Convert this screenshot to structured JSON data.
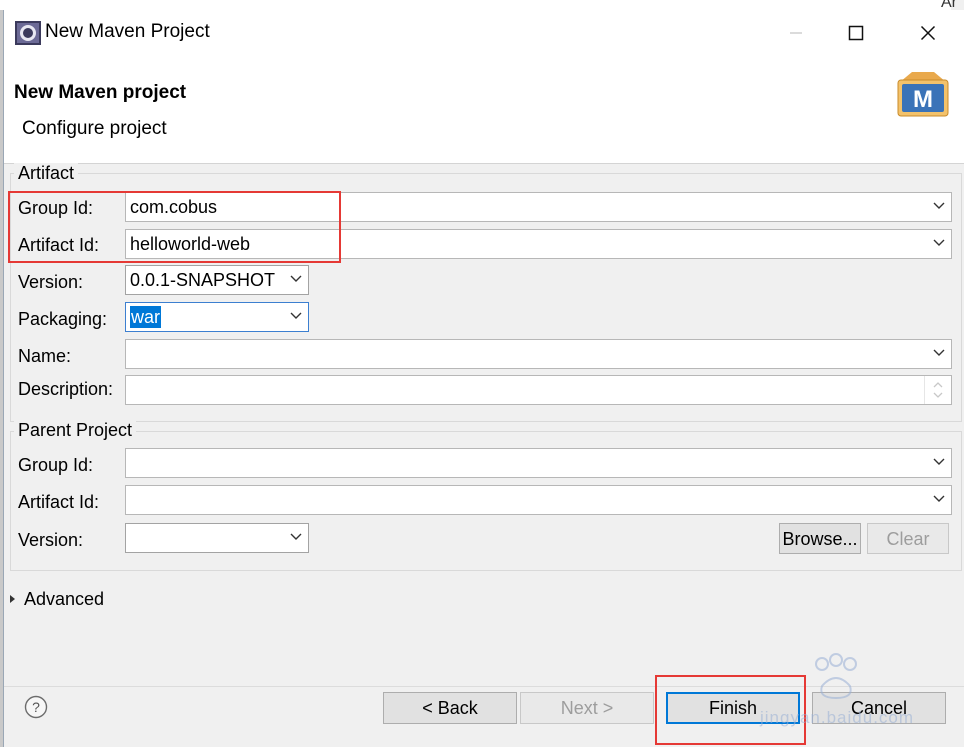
{
  "window": {
    "title": "New Maven Project",
    "edge_text": "Ar"
  },
  "banner": {
    "title": "New Maven project",
    "subtitle": "Configure project",
    "logo_letter": "M"
  },
  "artifact": {
    "legend": "Artifact",
    "group_id": {
      "label": "Group Id:",
      "value": "com.cobus"
    },
    "artifact_id": {
      "label": "Artifact Id:",
      "value": "helloworld-web"
    },
    "version": {
      "label": "Version:",
      "value": "0.0.1-SNAPSHOT"
    },
    "packaging": {
      "label": "Packaging:",
      "value": "war"
    },
    "name": {
      "label": "Name:",
      "value": ""
    },
    "description": {
      "label": "Description:",
      "value": ""
    }
  },
  "parent": {
    "legend": "Parent Project",
    "group_id": {
      "label": "Group Id:",
      "value": ""
    },
    "artifact_id": {
      "label": "Artifact Id:",
      "value": ""
    },
    "version": {
      "label": "Version:",
      "value": ""
    },
    "browse_label": "Browse...",
    "clear_label": "Clear"
  },
  "advanced": {
    "label": "Advanced"
  },
  "footer": {
    "help_glyph": "?",
    "back_label": "< Back",
    "next_label": "Next >",
    "finish_label": "Finish",
    "cancel_label": "Cancel"
  },
  "watermark": {
    "text": "jingyan.baidu.com"
  },
  "colors": {
    "highlight": "#e53935",
    "selection": "#0078d7",
    "dialog_bg": "#f0f0f0"
  }
}
